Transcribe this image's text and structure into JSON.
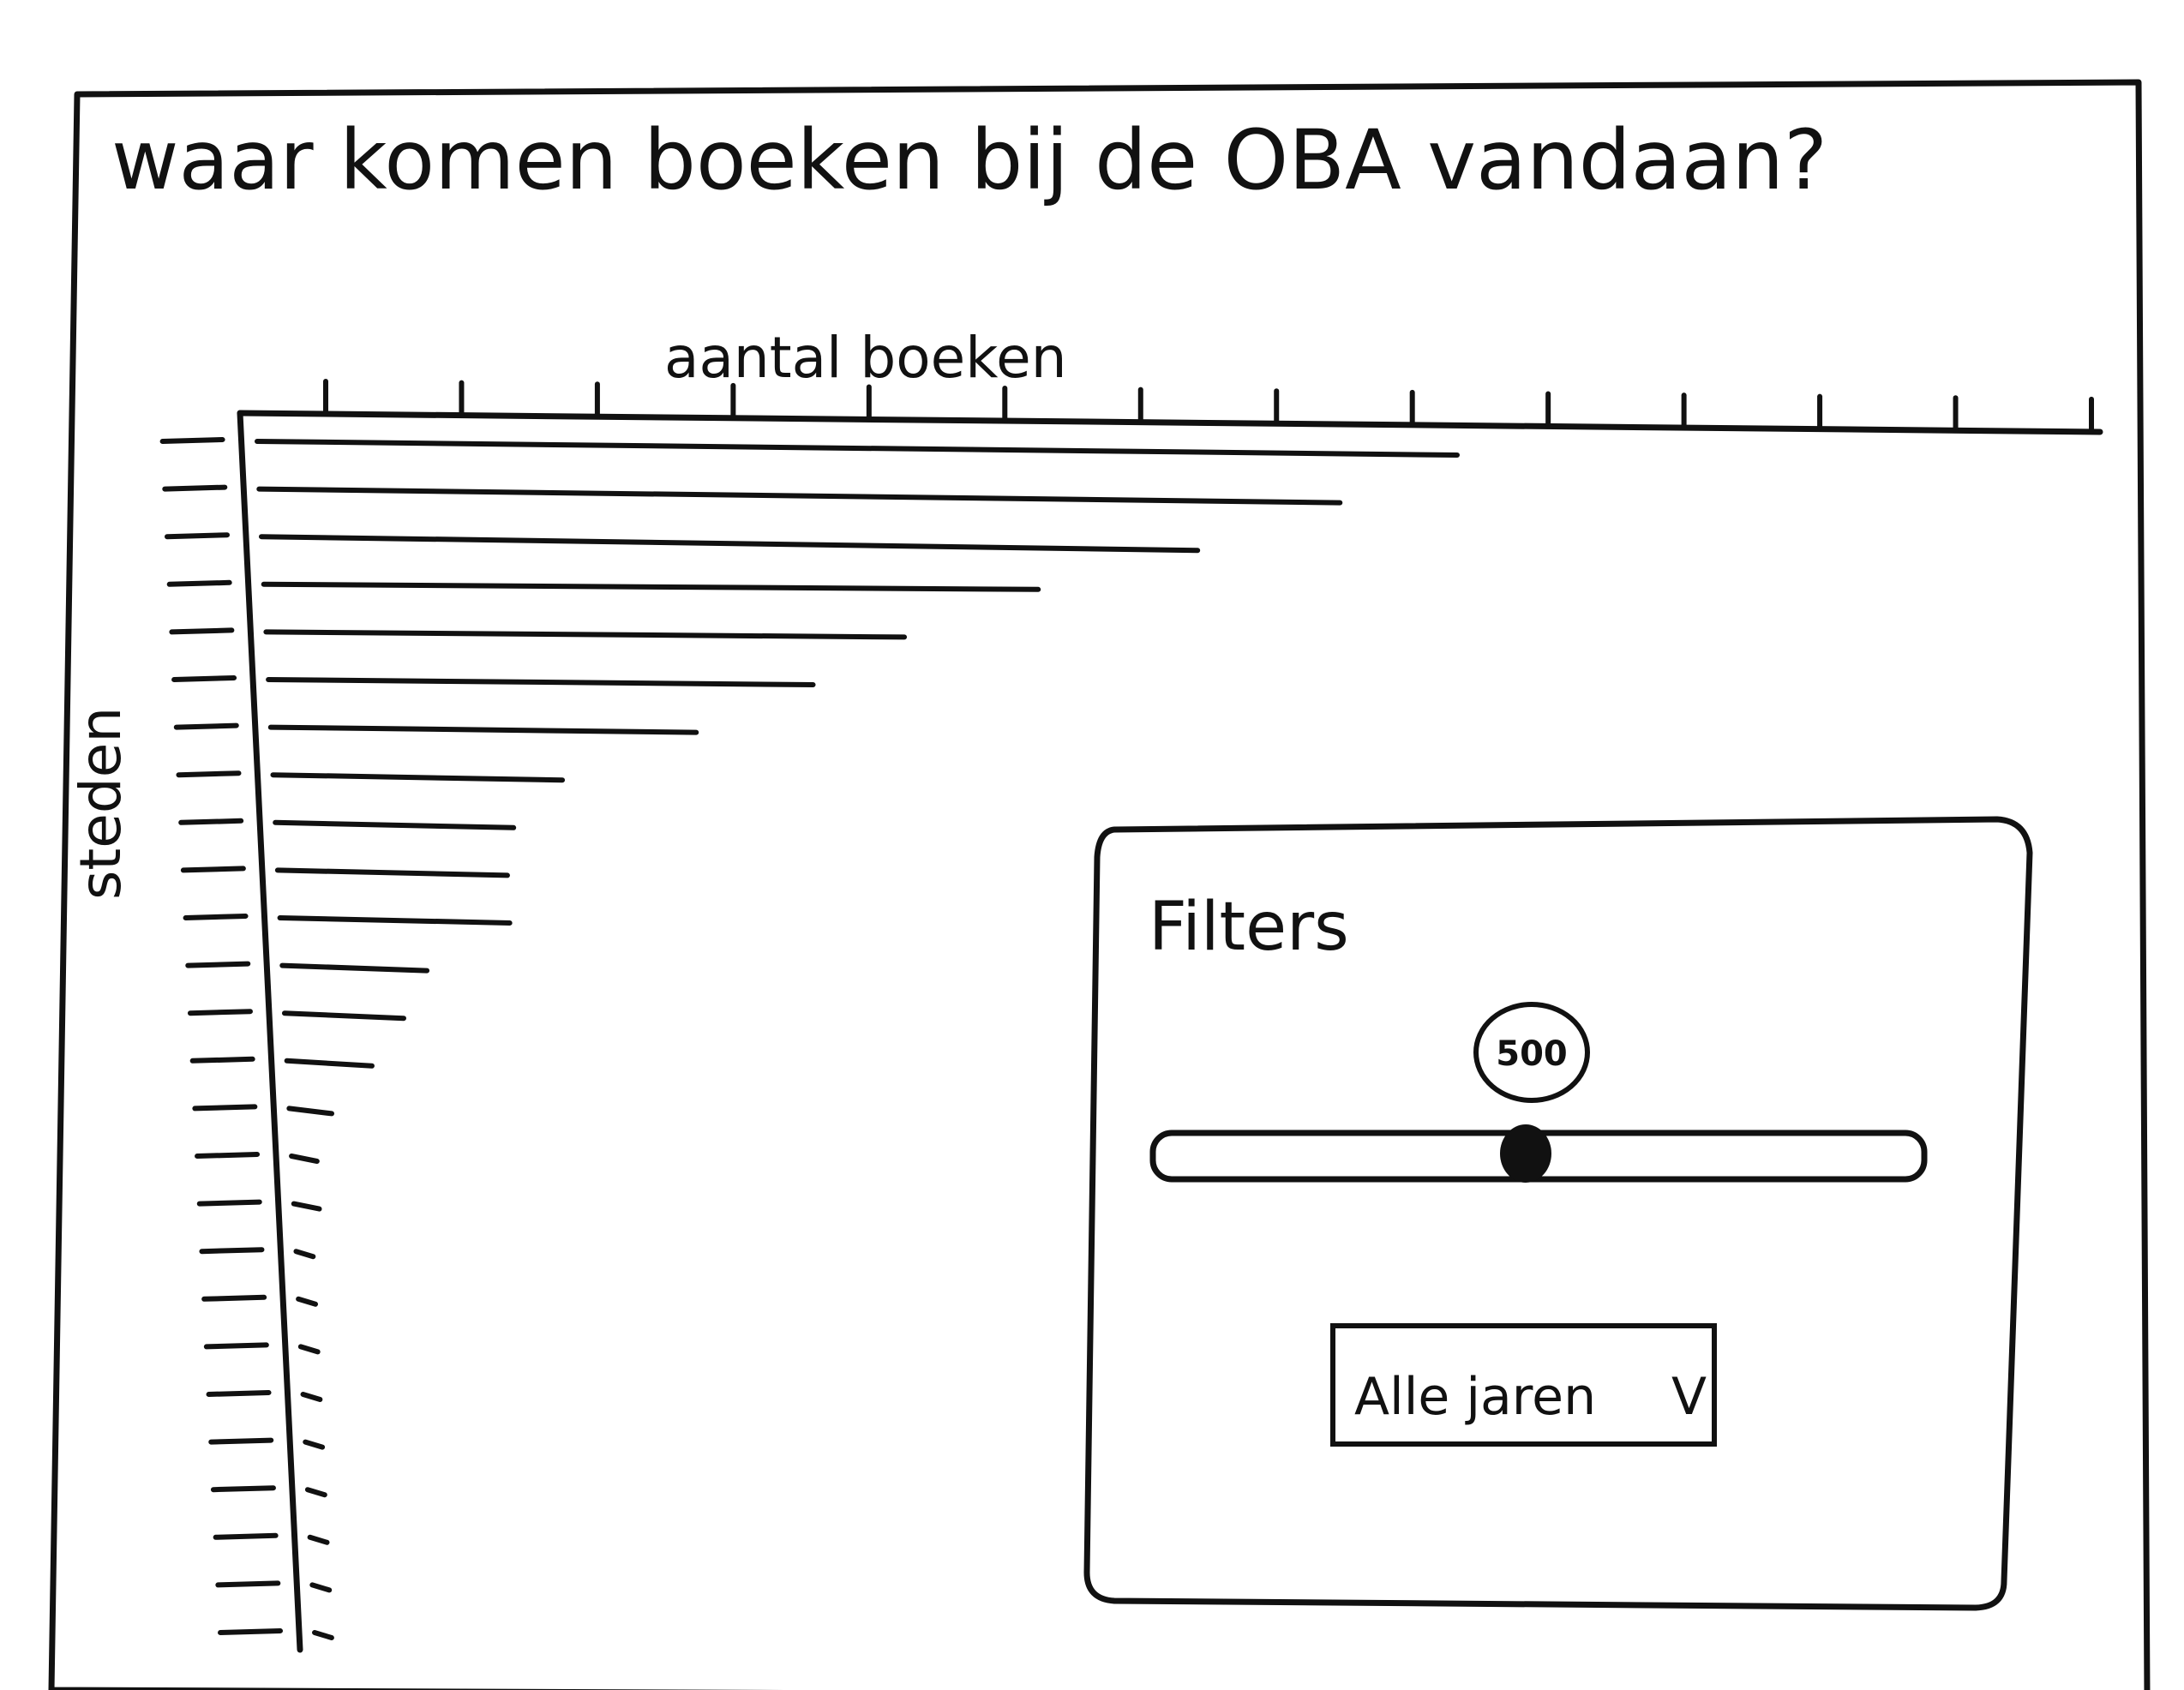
{
  "page": {
    "title": "waar komen boeken bij de OBA vandaan?"
  },
  "chart": {
    "x_axis_label": "aantal boeken",
    "y_axis_label": "steden"
  },
  "chart_data": {
    "type": "bar",
    "orientation": "horizontal",
    "title": "waar komen boeken bij de OBA vandaan?",
    "xlabel": "aantal boeken",
    "ylabel": "steden",
    "values": [
      1410,
      1270,
      1100,
      910,
      750,
      640,
      500,
      340,
      280,
      270,
      270,
      170,
      140,
      100,
      50,
      30,
      30,
      20,
      20,
      20,
      20,
      20,
      20,
      20,
      20,
      20
    ]
  },
  "filters": {
    "title": "Filters",
    "slider": {
      "value_label": "500",
      "fraction": 0.48
    },
    "dropdown": {
      "selected": "Alle jaren",
      "chevron": "V"
    }
  }
}
